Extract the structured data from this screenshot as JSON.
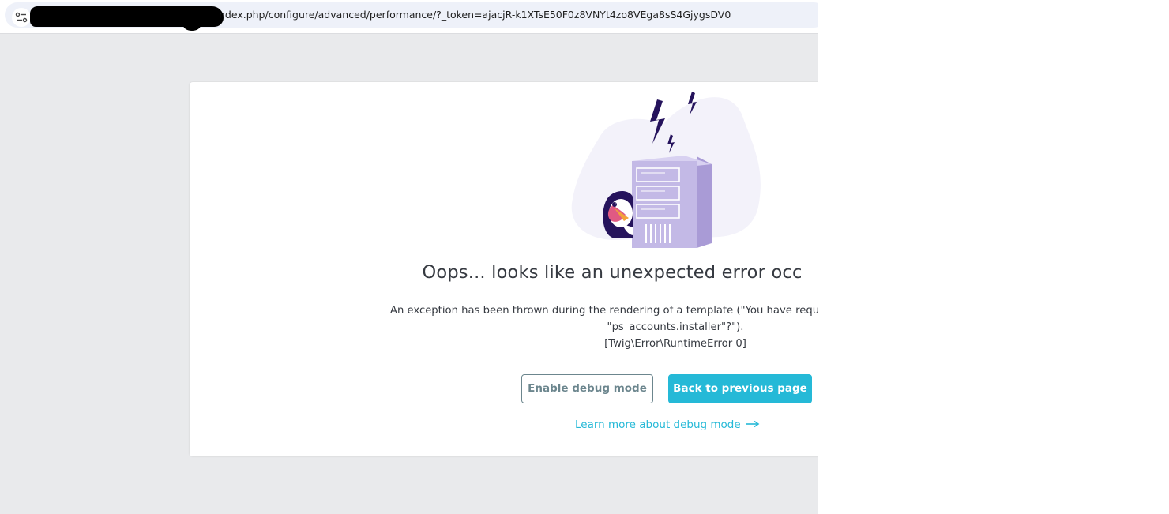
{
  "browser": {
    "url_visible": "ndex.php/configure/advanced/performance/?_token=ajacjR-k1XTsE50F0z8VNYt4zo8VEga8sS4GjygsDV0",
    "site_info_icon": "tune-icon"
  },
  "error": {
    "title": "Oops... looks like an unexpected error occ",
    "message_lines": [
      "An exception has been thrown during the rendering of a template (\"You have requested a non-existent servic",
      "\"ps_accounts.installer\"?\").",
      "[Twig\\Error\\RuntimeError 0]"
    ],
    "buttons": {
      "enable_debug": "Enable debug mode",
      "back": "Back to previous page"
    },
    "learn_more": "Learn more about debug mode",
    "learn_more_icon": "arrow-right-icon"
  },
  "colors": {
    "accent": "#25b9d7",
    "secondary": "#6c868e",
    "text": "#363a41",
    "background": "#e9eaec",
    "illustration_server": "#c3b9e6",
    "illustration_lightning": "#25135c"
  }
}
